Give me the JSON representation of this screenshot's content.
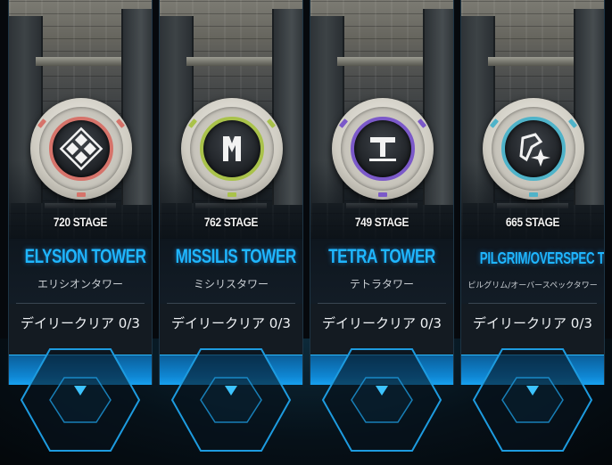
{
  "towers": [
    {
      "stage": "720 STAGE",
      "name": "ELYSION TOWER",
      "jp_name": "エリシオンタワー",
      "daily": "デイリークリア 0/3",
      "emblem_icon": "elysion-diamond-icon",
      "accent": "#d6736a"
    },
    {
      "stage": "762 STAGE",
      "name": "MISSILIS TOWER",
      "jp_name": "ミシリスタワー",
      "daily": "デイリークリア 0/3",
      "emblem_icon": "missilis-m-icon",
      "accent": "#a9c24a"
    },
    {
      "stage": "749 STAGE",
      "name": "TETRA TOWER",
      "jp_name": "テトラタワー",
      "daily": "デイリークリア 0/3",
      "emblem_icon": "tetra-t-icon",
      "accent": "#7b59c9"
    },
    {
      "stage": "665 STAGE",
      "name": "PILGRIM/OVERSPEC TOWER",
      "jp_name": "ピルグリム/オーバースペックタワー",
      "daily": "デイリークリア 0/3",
      "emblem_icon": "pilgrim-star-icon",
      "accent": "#4fb3c9"
    }
  ],
  "colors": {
    "title_blue": "#1fb6ff",
    "glow_blue": "#0f87d4",
    "hex_border": "#1d9bdf"
  }
}
